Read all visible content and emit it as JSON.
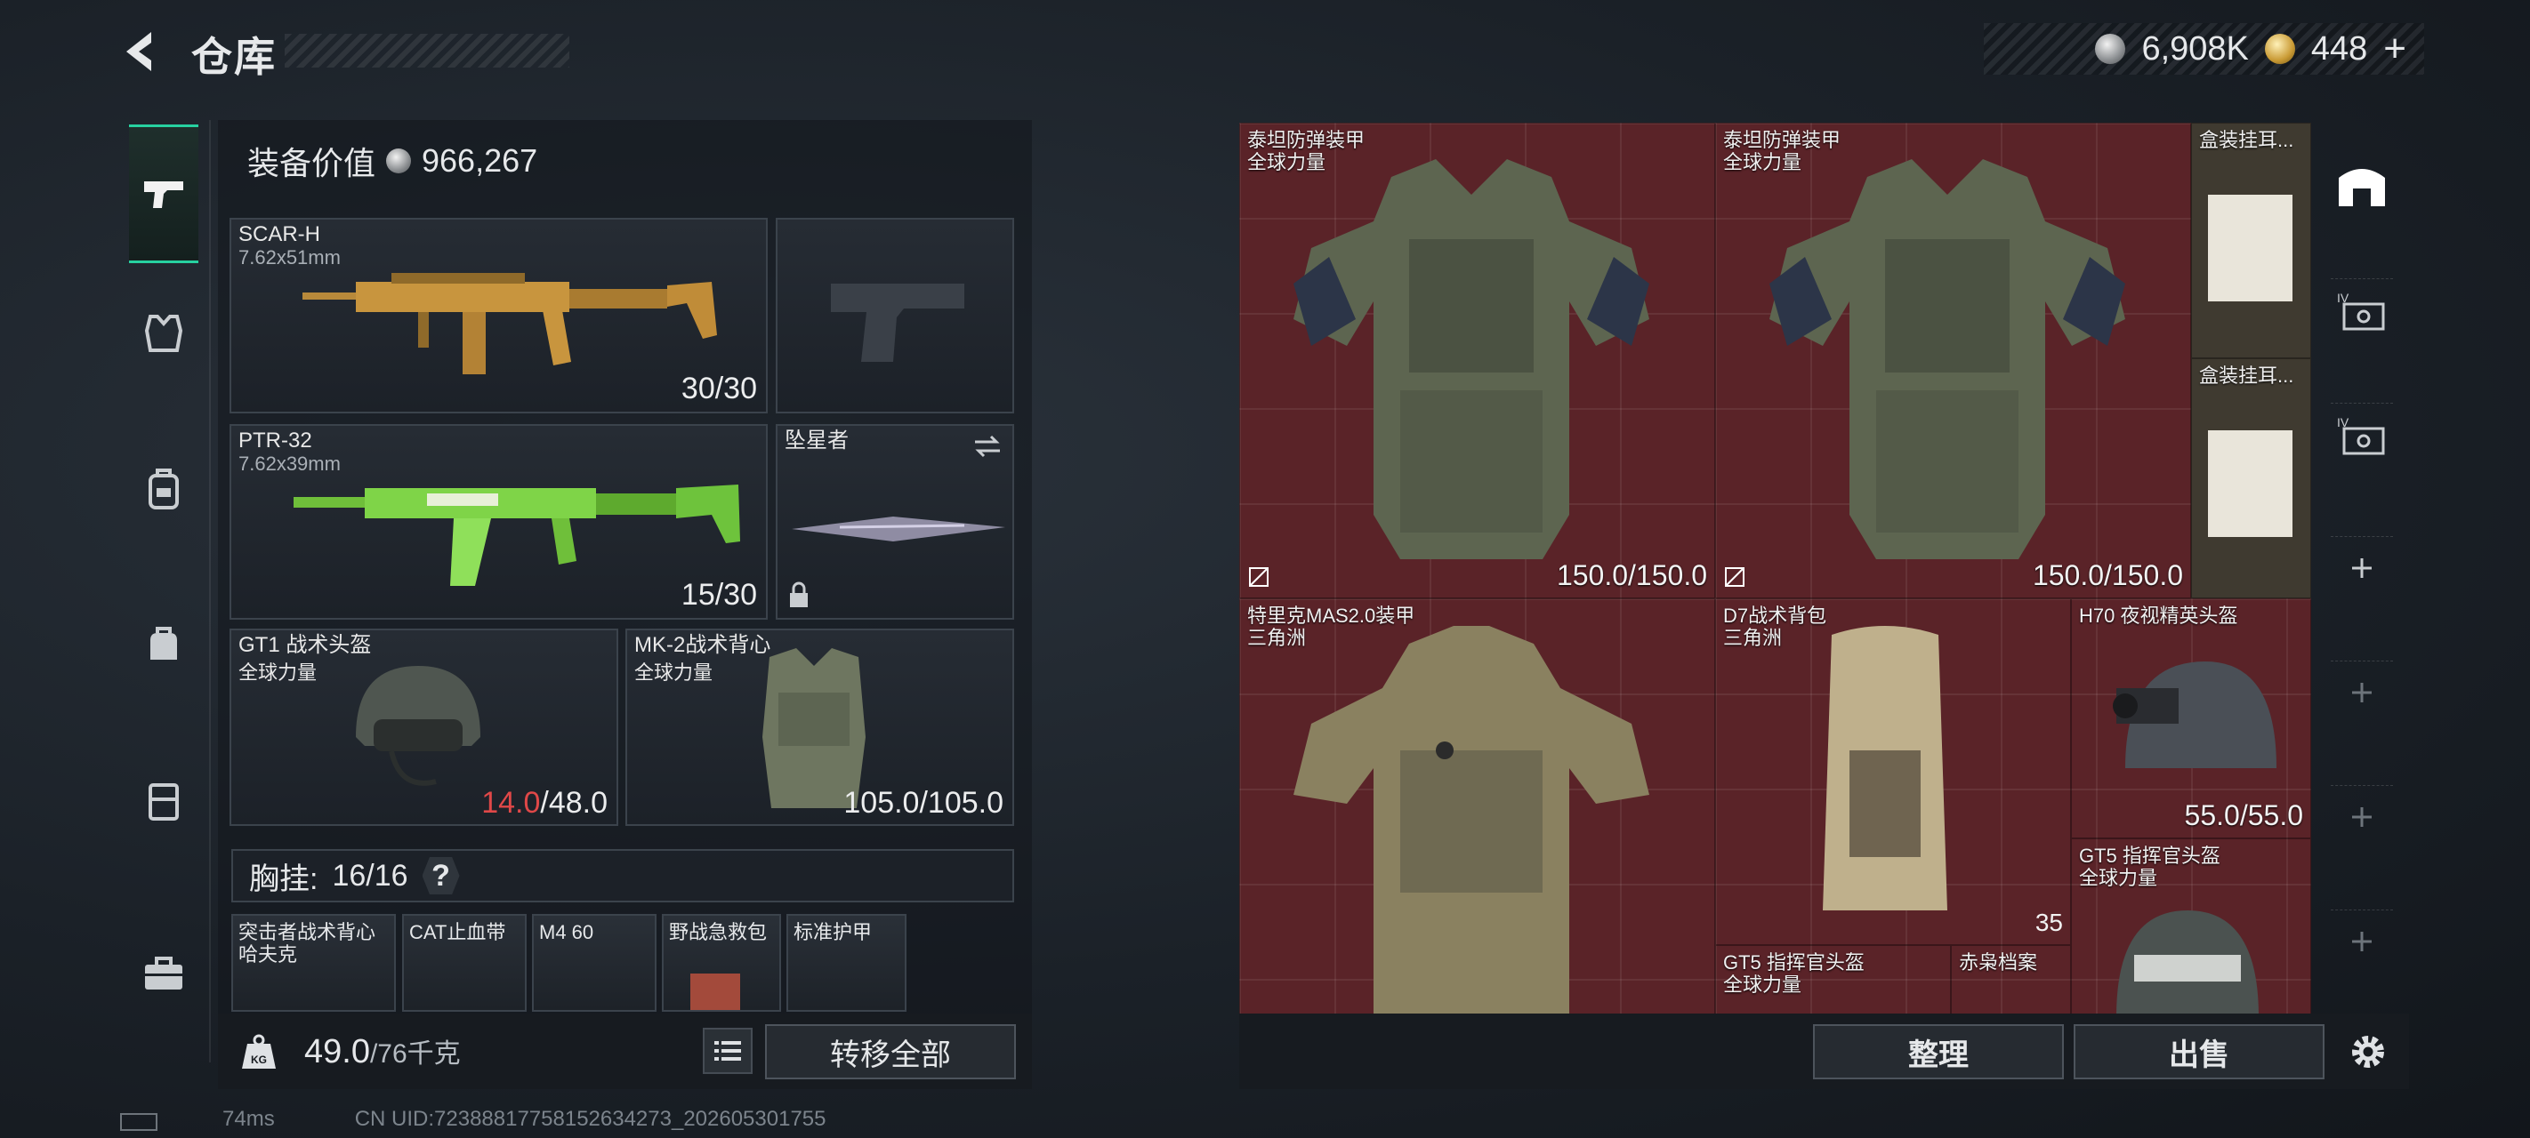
{
  "header": {
    "back_label": "back",
    "title": "仓库",
    "silver_amount": "6,908K",
    "gold_amount": "448",
    "gold_plus": "+"
  },
  "categories": [
    {
      "name": "weapons",
      "icon": "pistol-icon",
      "active": true
    },
    {
      "name": "armor",
      "icon": "vest-icon"
    },
    {
      "name": "backpack",
      "icon": "backpack-icon"
    },
    {
      "name": "bag",
      "icon": "bag-icon"
    },
    {
      "name": "container",
      "icon": "case-icon"
    },
    {
      "name": "toolbox",
      "icon": "toolbox-icon"
    }
  ],
  "equipment": {
    "value_label": "装备价值",
    "value": "966,267",
    "primary1": {
      "name": "SCAR-H",
      "caliber": "7.62x51mm",
      "ammo": "30/30"
    },
    "primary2": {
      "name": "PTR-32",
      "caliber": "7.62x39mm",
      "ammo": "15/30"
    },
    "melee": {
      "name": "坠星者"
    },
    "helmet": {
      "name": "GT1 战术头盔",
      "faction": "全球力量",
      "dur_cur": "14.0",
      "dur_max": "/48.0"
    },
    "armor": {
      "name": "MK-2战术背心",
      "faction": "全球力量",
      "durability": "105.0/105.0"
    },
    "rig_label": "胸挂:",
    "rig_count": "16/16",
    "rig_help": "?",
    "rig_items": [
      {
        "name": "突击者战术背心",
        "sub": "哈夫克"
      },
      {
        "name": "CAT止血带"
      },
      {
        "name": "M4 60"
      },
      {
        "name": "野战急救包"
      },
      {
        "name": "标准护甲"
      }
    ],
    "weight": "49.0",
    "weight_max": "/76千克",
    "transfer_all": "转移全部"
  },
  "storage": {
    "items": [
      {
        "name": "泰坦防弹装甲",
        "sub": "全球力量",
        "durability": "150.0/150.0"
      },
      {
        "name": "泰坦防弹装甲",
        "sub": "全球力量",
        "durability": "150.0/150.0"
      },
      {
        "name": "盒装挂耳..."
      },
      {
        "name": "盒装挂耳..."
      },
      {
        "name": "特里克MAS2.0装甲",
        "sub": "三角洲"
      },
      {
        "name": "D7战术背包",
        "sub": "三角洲",
        "count": "35"
      },
      {
        "name": "H70 夜视精英头盔",
        "durability": "55.0/55.0"
      },
      {
        "name": "GT5 指挥官头盔",
        "sub": "全球力量"
      },
      {
        "name": "GT5 指挥官头盔",
        "sub": "全球力量"
      },
      {
        "name": "赤枭档案"
      }
    ],
    "organize": "整理",
    "sell": "出售"
  },
  "footer": {
    "ping": "74ms",
    "uid": "CN UID:7238881775815263427​3_202605301755"
  },
  "colors": {
    "accent": "#27d1a0",
    "storage_bg": "#5a2328",
    "durability_low": "#e04848"
  }
}
